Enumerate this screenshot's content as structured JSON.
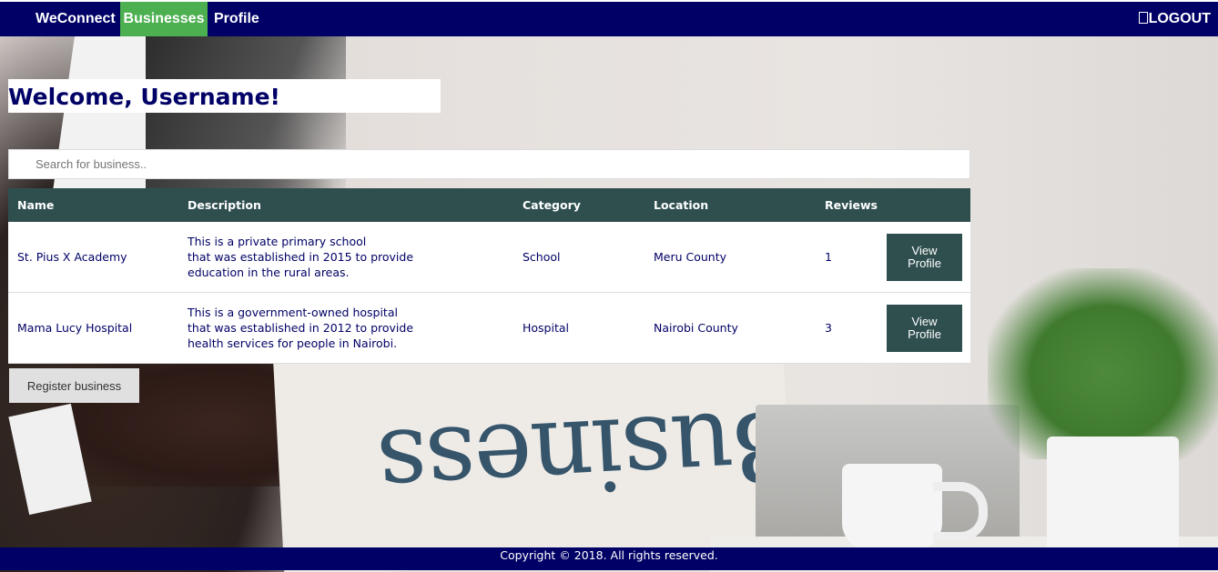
{
  "nav": {
    "brand": "WeConnect",
    "items": [
      {
        "label": "Businesses",
        "active": true
      },
      {
        "label": "Profile",
        "active": false
      }
    ],
    "logout_label": "LOGOUT"
  },
  "welcome": {
    "title": "Welcome, Username!"
  },
  "search": {
    "placeholder": "Search for business.."
  },
  "table": {
    "headers": [
      "Name",
      "Description",
      "Category",
      "Location",
      "Reviews"
    ],
    "rows": [
      {
        "name": "St. Pius X Academy",
        "description": [
          "This is a private primary school",
          "that was established in 2015 to provide",
          "education in the rural areas."
        ],
        "category": "School",
        "location": "Meru County",
        "reviews": "1",
        "action": "View Profile"
      },
      {
        "name": "Mama Lucy Hospital",
        "description": [
          "This is a government-owned hospital",
          "that was established in 2012 to provide",
          "health services for people in Nairobi."
        ],
        "category": "Hospital",
        "location": "Nairobi County",
        "reviews": "3",
        "action": "View Profile"
      }
    ]
  },
  "register_label": "Register business",
  "footer": {
    "copyright": "Copyright © 2018. All rights reserved."
  },
  "colors": {
    "navbar": "#000066",
    "active_tab": "#4caf50",
    "table_header": "#2f4f4f",
    "button": "#2f4f4f",
    "text": "#000066"
  },
  "background": {
    "newspaper_text": "Business"
  }
}
